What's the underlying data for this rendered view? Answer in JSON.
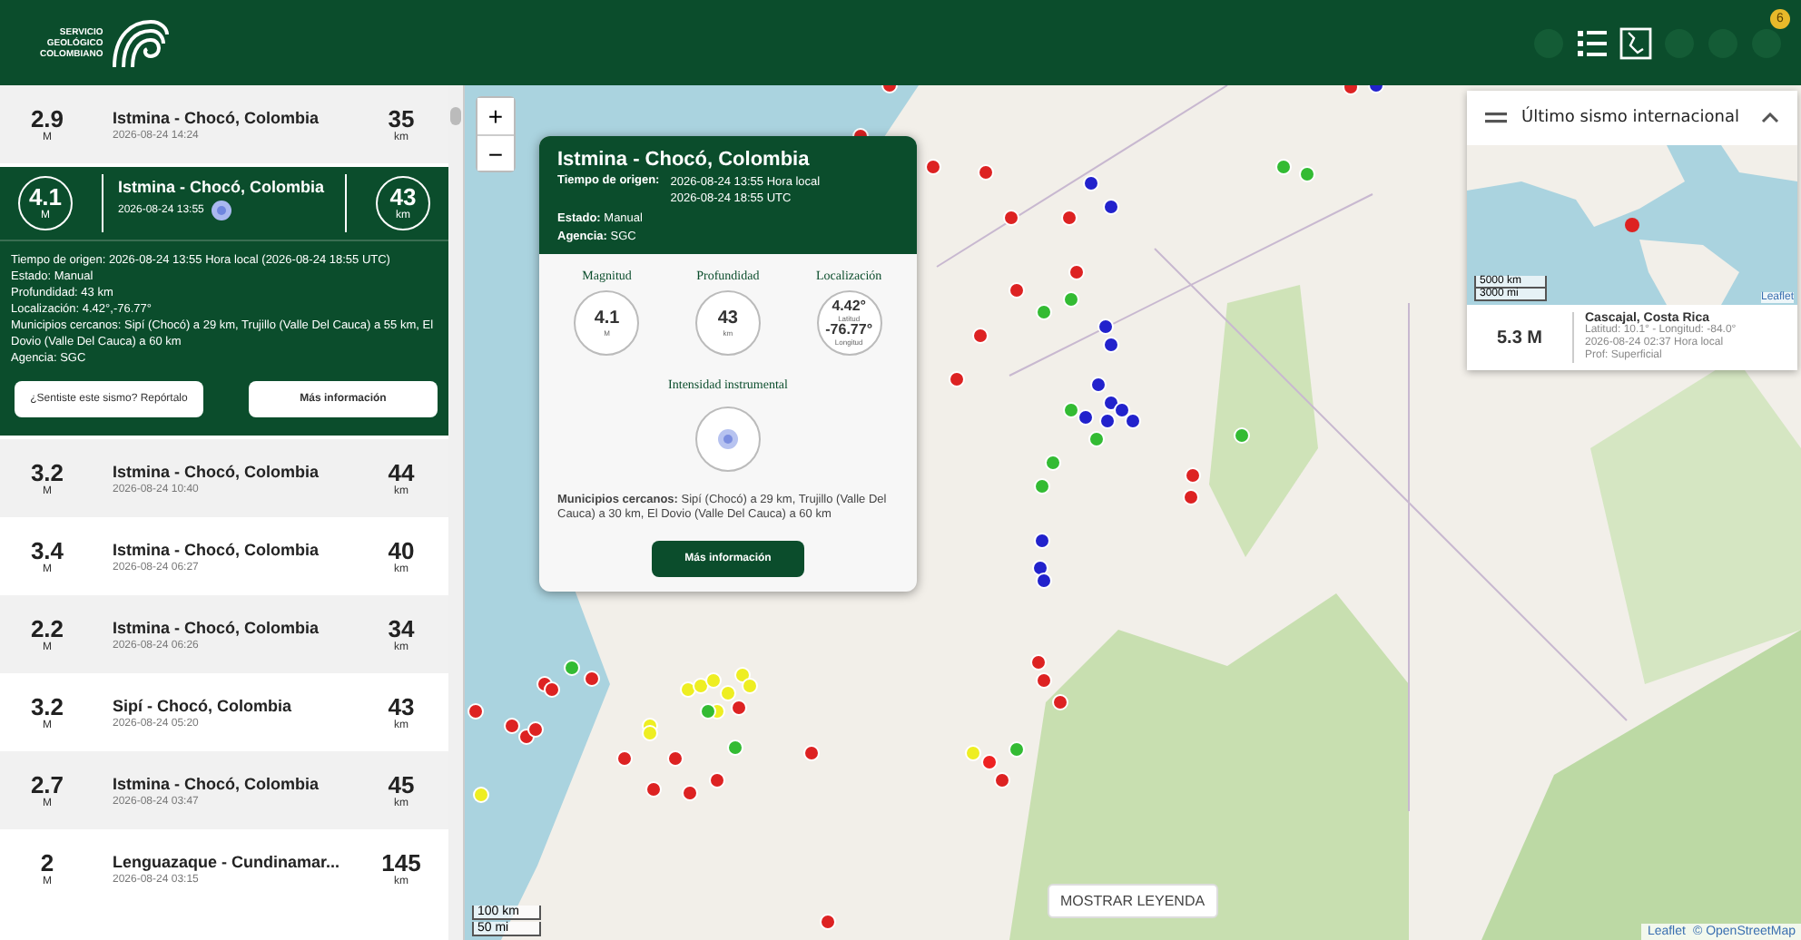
{
  "header": {
    "logo_lines": [
      "SERVICIO",
      "GEOLÓGICO",
      "COLOMBIANO"
    ],
    "notification_count": "6"
  },
  "events": [
    {
      "magnitude": "2.9",
      "mag_unit": "M",
      "place": "Istmina - Chocó, Colombia",
      "time": "2026-08-24 14:24",
      "depth": "35",
      "depth_unit": "km",
      "selected": false
    },
    {
      "magnitude": "4.1",
      "mag_unit": "M",
      "place": "Istmina - Chocó, Colombia",
      "time": "2026-08-24 13:55",
      "depth": "43",
      "depth_unit": "km",
      "selected": true,
      "details": [
        "Tiempo de origen: 2026-08-24 13:55 Hora local (2026-08-24 18:55 UTC)",
        "Estado: Manual",
        "Profundidad: 43 km",
        "Localización: 4.42°,-76.77°",
        "Municipios cercanos: Sipí (Chocó) a 29 km, Trujillo (Valle Del Cauca) a 55 km, El Dovio (Valle Del Cauca) a 60 km",
        "Agencia: SGC"
      ],
      "buttons": [
        "¿Sentiste este sismo? Repórtalo",
        "Más información"
      ]
    },
    {
      "magnitude": "3.2",
      "mag_unit": "M",
      "place": "Istmina - Chocó, Colombia",
      "time": "2026-08-24 10:40",
      "depth": "44",
      "depth_unit": "km",
      "selected": false
    },
    {
      "magnitude": "3.4",
      "mag_unit": "M",
      "place": "Istmina - Chocó, Colombia",
      "time": "2026-08-24 06:27",
      "depth": "40",
      "depth_unit": "km",
      "selected": false
    },
    {
      "magnitude": "2.2",
      "mag_unit": "M",
      "place": "Istmina - Chocó, Colombia",
      "time": "2026-08-24 06:26",
      "depth": "34",
      "depth_unit": "km",
      "selected": false
    },
    {
      "magnitude": "3.2",
      "mag_unit": "M",
      "place": "Sipí - Chocó, Colombia",
      "time": "2026-08-24 05:20",
      "depth": "43",
      "depth_unit": "km",
      "selected": false
    },
    {
      "magnitude": "2.7",
      "mag_unit": "M",
      "place": "Istmina - Chocó, Colombia",
      "time": "2026-08-24 03:47",
      "depth": "45",
      "depth_unit": "km",
      "selected": false
    },
    {
      "magnitude": "2",
      "mag_unit": "M",
      "place": "Lenguazaque - Cundinamar...",
      "time": "2026-08-24 03:15",
      "depth": "145",
      "depth_unit": "km",
      "selected": false
    }
  ],
  "map": {
    "zoom_in": "+",
    "zoom_out": "−",
    "scale": [
      "100 km",
      "50 mi"
    ],
    "legend_button": "MOSTRAR LEYENDA",
    "attribution": [
      "Leaflet",
      "© OpenStreetMap"
    ]
  },
  "popup": {
    "title": "Istmina - Chocó, Colombia",
    "origin_label": "Tiempo de origen:",
    "origin_times": [
      "2026-08-24 13:55 Hora local",
      "2026-08-24 18:55 UTC"
    ],
    "status": "**Estado:** Manual",
    "agency": "**Agencia:** SGC",
    "stats": [
      {
        "label": "Magnitud",
        "lines": [
          "4.1",
          "M"
        ]
      },
      {
        "label": "Profundidad",
        "lines": [
          "43",
          "km"
        ]
      },
      {
        "label": "Localización",
        "lines": [
          "4.42°",
          "Latitud",
          "-76.77°",
          "Longitud"
        ]
      }
    ],
    "intensity_label": "Intensidad instrumental",
    "municipalities": "**Municipios cercanos:** Sipí (Chocó) a 29 km, Trujillo (Valle Del Cauca) a 30 km, El Dovio (Valle Del Cauca) a 60 km",
    "button": "Más información"
  },
  "international": {
    "title": "Último sismo internacional",
    "expanded": true,
    "scale": [
      "5000 km",
      "3000 mi"
    ],
    "attribution": "Leaflet",
    "magnitude": "5.3 M",
    "place": "Cascajal, Costa Rica",
    "lines": [
      "Latitud: 10.1° - Longitud: -84.0°",
      "2026-08-24 02:37 Hora local",
      "Prof: Superficial"
    ]
  }
}
